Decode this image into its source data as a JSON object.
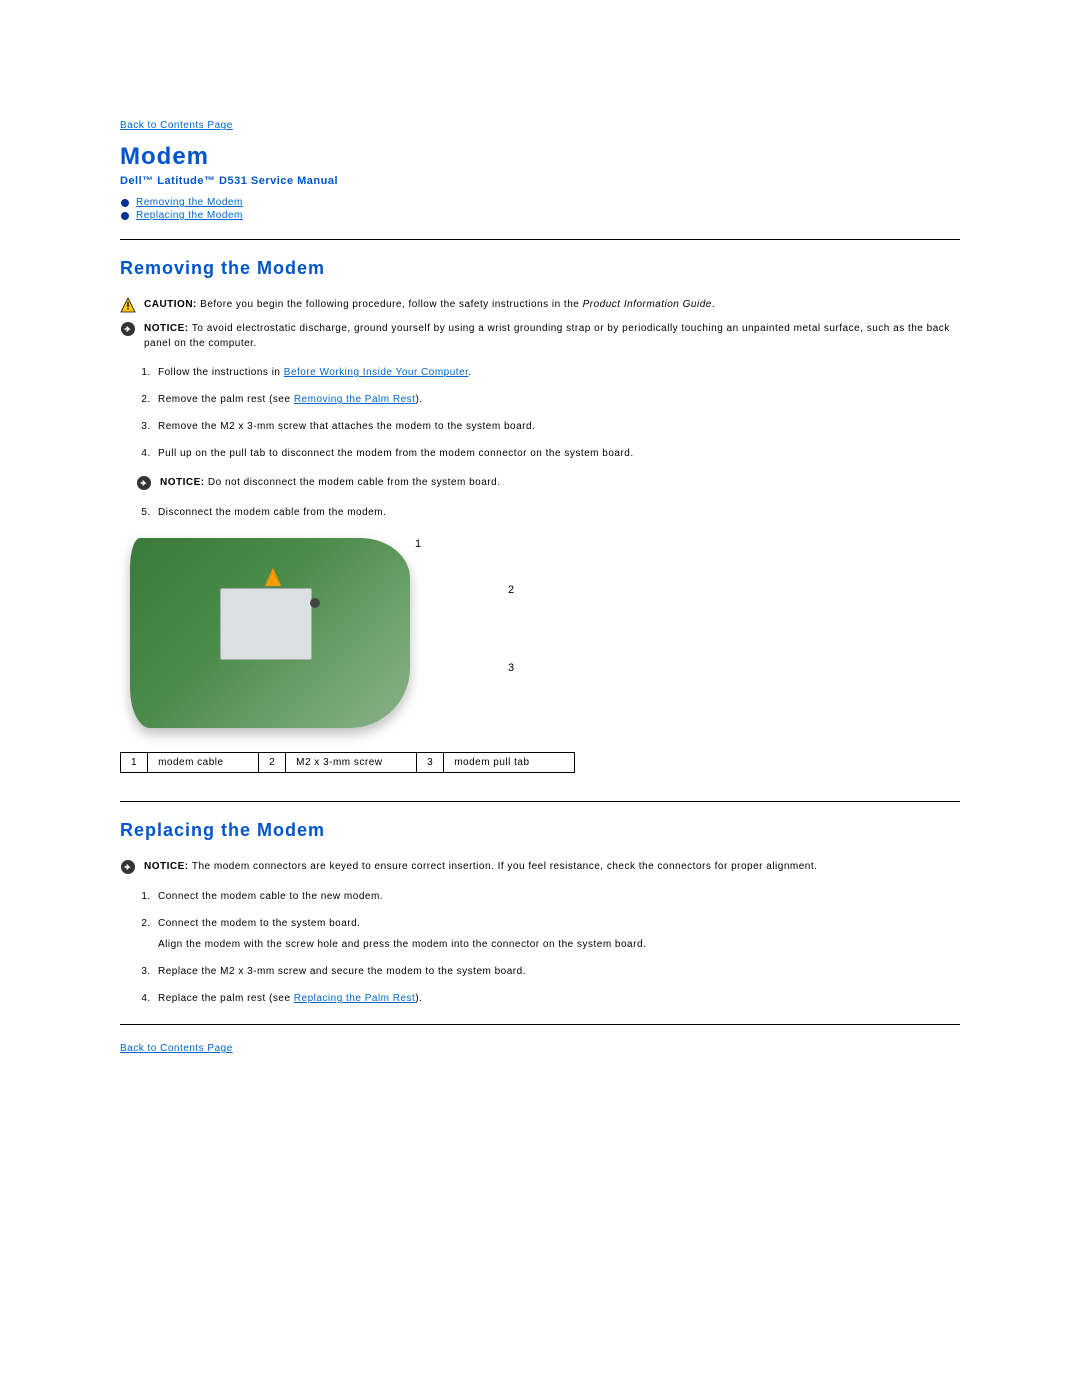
{
  "nav": {
    "back_top": "Back to Contents Page",
    "back_bottom": "Back to Contents Page"
  },
  "header": {
    "title": "Modem",
    "subtitle": "Dell™ Latitude™ D531 Service Manual"
  },
  "toc": {
    "item1": "Removing the Modem",
    "item2": "Replacing the Modem"
  },
  "removing": {
    "heading": "Removing the Modem",
    "caution_label": "CAUTION: ",
    "caution_text_a": "Before you begin the following procedure, follow the safety instructions in the ",
    "caution_text_b": "Product Information Guide",
    "caution_text_c": ".",
    "notice1_label": "NOTICE: ",
    "notice1_text": "To avoid electrostatic discharge, ground yourself by using a wrist grounding strap or by periodically touching an unpainted metal surface, such as the back panel on the computer.",
    "step1_a": "Follow the instructions in ",
    "step1_link": "Before Working Inside Your Computer",
    "step1_b": ".",
    "step2_a": "Remove the palm rest (see ",
    "step2_link": "Removing the Palm Rest",
    "step2_b": ").",
    "step3": "Remove the M2 x 3-mm screw that attaches the modem to the system board.",
    "step4": "Pull up on the pull tab to disconnect the modem from the modem connector on the system board.",
    "notice2_label": "NOTICE: ",
    "notice2_text": "Do not disconnect the modem cable from the system board.",
    "step5": "Disconnect the modem cable from the modem.",
    "labels": {
      "l1": "1",
      "l2": "2",
      "l3": "3"
    },
    "table": {
      "n1": "1",
      "t1": "modem cable",
      "n2": "2",
      "t2": "M2 x 3-mm screw",
      "n3": "3",
      "t3": "modem pull tab"
    }
  },
  "replacing": {
    "heading": "Replacing the Modem",
    "notice_label": "NOTICE: ",
    "notice_text": "The modem connectors are keyed to ensure correct insertion. If you feel resistance, check the connectors for proper alignment.",
    "step1": "Connect the modem cable to the new modem.",
    "step2": "Connect the modem to the system board.",
    "step2_sub": "Align the modem with the screw hole and press the modem into the connector on the system board.",
    "step3": "Replace the M2 x 3-mm screw and secure the modem to the system board.",
    "step4_a": "Replace the palm rest (see ",
    "step4_link": "Replacing the Palm Rest",
    "step4_b": ")."
  }
}
